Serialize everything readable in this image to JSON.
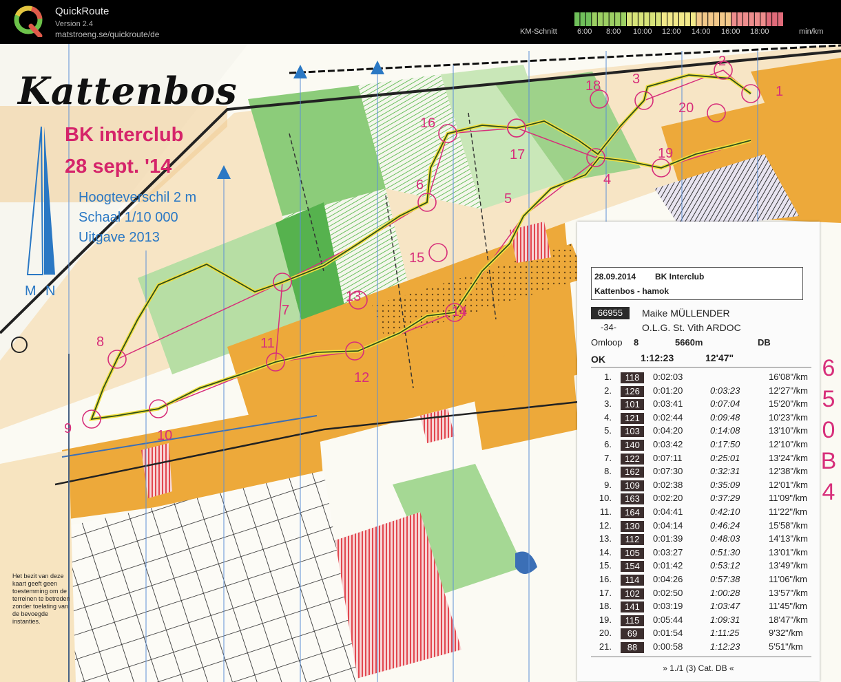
{
  "app": {
    "title": "QuickRoute",
    "version": "Version 2.4",
    "url": "matstroeng.se/quickroute/de",
    "legend_caption": "KM-Schnitt",
    "legend_ticks": [
      "6:00",
      "8:00",
      "10:00",
      "12:00",
      "14:00",
      "16:00",
      "18:00"
    ],
    "legend_unit": "min/km",
    "legend_colors": [
      "#6fbf5a",
      "#9ccf63",
      "#d7e37a",
      "#f3e98a",
      "#f3c98a",
      "#ee8d8d",
      "#e06b7a"
    ]
  },
  "map": {
    "title": "Kattenbos",
    "event_line1": "BK interclub",
    "event_line2": "28 sept. '14",
    "info": [
      "Hoogteverschil 2 m",
      "Schaal 1/10 000",
      "Uitgave 2013"
    ],
    "north_labels": [
      "M",
      "N"
    ],
    "disclaimer": "Het bezit van deze kaart geeft geen toestemming om de terreinen te betreden zonder toelating van de bevoegde instanties.",
    "side_code": [
      "6",
      "5",
      "0",
      "B",
      "4"
    ],
    "controls": [
      "1",
      "2",
      "3",
      "4",
      "5",
      "6",
      "7",
      "8",
      "9",
      "10",
      "11",
      "12",
      "13",
      "14",
      "15",
      "16",
      "17",
      "18",
      "19",
      "20"
    ],
    "colors": {
      "course": "#d72e7a",
      "route": "#2f4f1a",
      "north_arrow": "#2a78c4",
      "open_land": "#eda93a",
      "forest_green": "#8ccc7a"
    }
  },
  "card": {
    "date": "28.09.2014",
    "event": "BK Interclub",
    "map_name": "Kattenbos - hamok",
    "runner_id": "66955",
    "runner_name": "Maike MÜLLENDER",
    "runner_age": "-34-",
    "club": "O.L.G. St. Vith ARDOC",
    "course_label": "Omloop",
    "course": "8",
    "distance": "5660m",
    "category": "DB",
    "status": "OK",
    "total_time": "1:12:23",
    "avg_pace": "12'47\"",
    "splits": [
      {
        "n": "1.",
        "code": "118",
        "time": "0:02:03",
        "cum": "",
        "pace": "16'08\"/km"
      },
      {
        "n": "2.",
        "code": "126",
        "time": "0:01:20",
        "cum": "0:03:23",
        "pace": "12'27\"/km"
      },
      {
        "n": "3.",
        "code": "101",
        "time": "0:03:41",
        "cum": "0:07:04",
        "pace": "15'20\"/km"
      },
      {
        "n": "4.",
        "code": "121",
        "time": "0:02:44",
        "cum": "0:09:48",
        "pace": "10'23\"/km"
      },
      {
        "n": "5.",
        "code": "103",
        "time": "0:04:20",
        "cum": "0:14:08",
        "pace": "13'10\"/km"
      },
      {
        "n": "6.",
        "code": "140",
        "time": "0:03:42",
        "cum": "0:17:50",
        "pace": "12'10\"/km"
      },
      {
        "n": "7.",
        "code": "122",
        "time": "0:07:11",
        "cum": "0:25:01",
        "pace": "13'24\"/km"
      },
      {
        "n": "8.",
        "code": "162",
        "time": "0:07:30",
        "cum": "0:32:31",
        "pace": "12'38\"/km"
      },
      {
        "n": "9.",
        "code": "109",
        "time": "0:02:38",
        "cum": "0:35:09",
        "pace": "12'01\"/km"
      },
      {
        "n": "10.",
        "code": "163",
        "time": "0:02:20",
        "cum": "0:37:29",
        "pace": "11'09\"/km"
      },
      {
        "n": "11.",
        "code": "164",
        "time": "0:04:41",
        "cum": "0:42:10",
        "pace": "11'22\"/km"
      },
      {
        "n": "12.",
        "code": "130",
        "time": "0:04:14",
        "cum": "0:46:24",
        "pace": "15'58\"/km"
      },
      {
        "n": "13.",
        "code": "112",
        "time": "0:01:39",
        "cum": "0:48:03",
        "pace": "14'13\"/km"
      },
      {
        "n": "14.",
        "code": "105",
        "time": "0:03:27",
        "cum": "0:51:30",
        "pace": "13'01\"/km"
      },
      {
        "n": "15.",
        "code": "154",
        "time": "0:01:42",
        "cum": "0:53:12",
        "pace": "13'49\"/km"
      },
      {
        "n": "16.",
        "code": "114",
        "time": "0:04:26",
        "cum": "0:57:38",
        "pace": "11'06\"/km"
      },
      {
        "n": "17.",
        "code": "102",
        "time": "0:02:50",
        "cum": "1:00:28",
        "pace": "13'57\"/km"
      },
      {
        "n": "18.",
        "code": "141",
        "time": "0:03:19",
        "cum": "1:03:47",
        "pace": "11'45\"/km"
      },
      {
        "n": "19.",
        "code": "115",
        "time": "0:05:44",
        "cum": "1:09:31",
        "pace": "18'47\"/km"
      },
      {
        "n": "20.",
        "code": "69",
        "time": "0:01:54",
        "cum": "1:11:25",
        "pace": "9'32\"/km"
      },
      {
        "n": "21.",
        "code": "88",
        "time": "0:00:58",
        "cum": "1:12:23",
        "pace": "5'51\"/km"
      }
    ],
    "footer": "» 1./1 (3) Cat. DB «"
  }
}
